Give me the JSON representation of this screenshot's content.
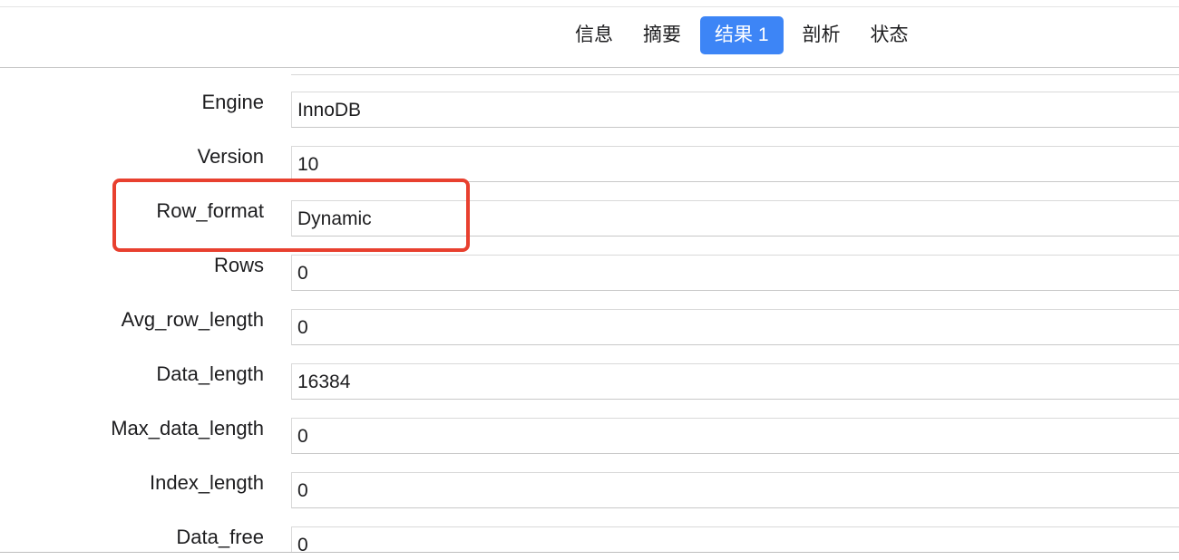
{
  "tabs": [
    {
      "label": "信息",
      "active": false
    },
    {
      "label": "摘要",
      "active": false
    },
    {
      "label": "结果 1",
      "active": true
    },
    {
      "label": "剖析",
      "active": false
    },
    {
      "label": "状态",
      "active": false
    }
  ],
  "fields": [
    {
      "label": "Engine",
      "value": "InnoDB"
    },
    {
      "label": "Version",
      "value": "10"
    },
    {
      "label": "Row_format",
      "value": "Dynamic"
    },
    {
      "label": "Rows",
      "value": "0"
    },
    {
      "label": "Avg_row_length",
      "value": "0"
    },
    {
      "label": "Data_length",
      "value": "16384"
    },
    {
      "label": "Max_data_length",
      "value": "0"
    },
    {
      "label": "Index_length",
      "value": "0"
    },
    {
      "label": "Data_free",
      "value": "0"
    }
  ],
  "highlight": {
    "field": "Row_format",
    "color": "#e8402f"
  },
  "colors": {
    "accent": "#3d85f6",
    "highlight": "#e8402f"
  }
}
